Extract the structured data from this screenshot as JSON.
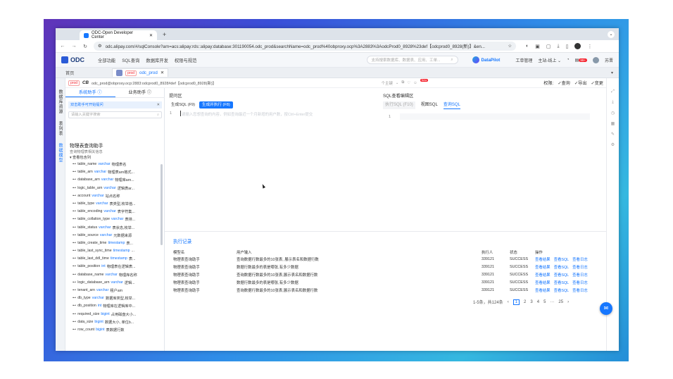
{
  "browser": {
    "tab_title": "ODC-Open Developer Center",
    "url": "odc.alipay.com/#/sqlConsole?arn=acs:alipay:rds::alipay:database:301190054.odc_prod&searchName=odc_prod%40obproxy.ocp%3A2883%3AodcProd0_8928%23def【odcprod0_8928(新)】&en..."
  },
  "header": {
    "logo": "ODC",
    "nav": [
      "全部功能",
      "SQL查询",
      "数据库开发",
      "权限与规范"
    ],
    "search_placeholder": "支持搜索数据库、数据表、应用、工单...",
    "datapilot": "DataPilot",
    "workorder": "工单管理",
    "site": "主站-线上",
    "badge": "99+",
    "user": "苏晋"
  },
  "pagetabs": {
    "home": "首页",
    "env": "prod",
    "name": "odc_prod"
  },
  "leftrail": [
    "数据库资源",
    "表列表",
    "数据模型"
  ],
  "connbar": {
    "env": "prod",
    "label": "CB",
    "path": "odc_prod@obproxy.ocp:2883:odcprod0_8928#def【odcprod0_8928(新)】",
    "select": "个主键",
    "new_badge": "New",
    "perm_label": "权限:",
    "perms": [
      "✓查询",
      "✓导出",
      "✓变更"
    ]
  },
  "assistant": {
    "tabs": [
      "系统助手",
      "业务助手"
    ],
    "tip": "双击助手可开始提问",
    "search_placeholder": "请输入关键字搜索",
    "title": "物理表查询助手",
    "subtitle": "查询物理表相关信息",
    "tree_label": "查看包含列",
    "columns": [
      {
        "name": "table_name",
        "type": "varchar",
        "desc": "物理表名"
      },
      {
        "name": "table_arn",
        "type": "varchar",
        "desc": "物理表arn格式..."
      },
      {
        "name": "database_arn",
        "type": "varchar",
        "desc": "物理库arn..."
      },
      {
        "name": "logic_table_arn",
        "type": "varchar",
        "desc": "逻辑表ar..."
      },
      {
        "name": "account",
        "type": "varchar",
        "desc": "站点名称"
      },
      {
        "name": "table_type",
        "type": "varchar",
        "desc": "表类型,枚举值..."
      },
      {
        "name": "table_encoding",
        "type": "varchar",
        "desc": "表字符集..."
      },
      {
        "name": "table_collation_type",
        "type": "varchar",
        "desc": "表排..."
      },
      {
        "name": "table_status",
        "type": "varchar",
        "desc": "表状态,枚举..."
      },
      {
        "name": "table_source",
        "type": "varchar",
        "desc": "元数据来源"
      },
      {
        "name": "table_create_time",
        "type": "timestamp",
        "desc": "表..."
      },
      {
        "name": "table_last_sync_time",
        "type": "timestamp",
        "desc": "..."
      },
      {
        "name": "table_last_ddl_time",
        "type": "timestamp",
        "desc": "表..."
      },
      {
        "name": "table_position",
        "type": "int",
        "desc": "物理表在逻辑表..."
      },
      {
        "name": "database_name",
        "type": "varchar",
        "desc": "物理库名称"
      },
      {
        "name": "logic_database_arn",
        "type": "varchar",
        "desc": "逻辑..."
      },
      {
        "name": "tenant_arn",
        "type": "varchar",
        "desc": "租户arn"
      },
      {
        "name": "db_type",
        "type": "varchar",
        "desc": "数据库类型,枚举..."
      },
      {
        "name": "db_position",
        "type": "int",
        "desc": "物理库在逻辑库中..."
      },
      {
        "name": "required_size",
        "type": "bigint",
        "desc": "占用磁盘大小..."
      },
      {
        "name": "data_size",
        "type": "bigint",
        "desc": "数据大小, 单位b..."
      },
      {
        "name": "row_count",
        "type": "bigint",
        "desc": "表数据行数"
      }
    ]
  },
  "editor": {
    "hints_label": "提问区",
    "btn_gen": "生成SQL (F9)",
    "btn_gen_exec": "生成并执行 (F8)",
    "line": "1",
    "placeholder": "请输入您想查询的内容，例如查询最近一个月新增的用户数，按Ctrl+Enter提交",
    "sql_label": "SQL查看编辑区",
    "sql_tabs": [
      "执行SQL (F10)",
      "视图SQL",
      "查询SQL"
    ],
    "sql_line": "1"
  },
  "exec": {
    "title": "执行记录",
    "headers": [
      "模型名",
      "用户输入",
      "执行人",
      "状态",
      "操作"
    ],
    "rows": [
      {
        "model": "物理表查询助手",
        "input": "查询数据行数最多的10张表, 展示表名和数据行数",
        "user": "339121",
        "status": "SUCCESS"
      },
      {
        "model": "物理表查询助手",
        "input": "数据行数最多的表是哪张,有多少数据",
        "user": "339121",
        "status": "SUCCESS"
      },
      {
        "model": "物理表查询助手",
        "input": "查询数据行数最多的10张表,展示表名和数据行数",
        "user": "339121",
        "status": "SUCCESS"
      },
      {
        "model": "物理表查询助手",
        "input": "数据行数最多的表是哪张,有多少数据",
        "user": "339121",
        "status": "SUCCESS"
      },
      {
        "model": "物理表查询助手",
        "input": "查询数据行数最多的10张表,展示表名和数据行数",
        "user": "339121",
        "status": "SUCCESS"
      }
    ],
    "ops": [
      "查看结果",
      "查看SQL",
      "查看日志"
    ],
    "pager_total": "1-5条，共124条",
    "pages": [
      "1",
      "2",
      "3",
      "4",
      "5",
      "···",
      "25"
    ]
  }
}
